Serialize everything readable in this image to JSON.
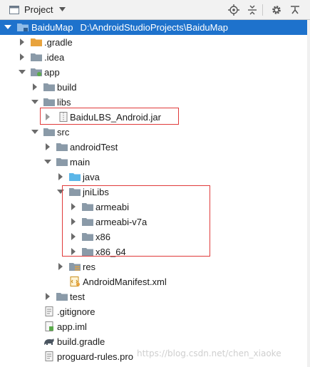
{
  "toolbar": {
    "title": "Project",
    "caret_icon": "dropdown-caret-icon",
    "buttons": [
      "locate-icon",
      "collapse-all-icon",
      "gear-icon",
      "hide-panel-icon"
    ]
  },
  "colors": {
    "selection": "#1e72cc",
    "folder": "#8a9aa8",
    "gradle_folder": "#e8a33d",
    "source_folder": "#5bb6e8",
    "highlight_box": "#e03a3a"
  },
  "tree": {
    "root": {
      "name": "BaiduMap",
      "path": "D:\\AndroidStudioProjects\\BaiduMap"
    },
    "gradle": ".gradle",
    "idea": ".idea",
    "app": "app",
    "build": "build",
    "libs": "libs",
    "jar": "BaiduLBS_Android.jar",
    "src": "src",
    "androidTest": "androidTest",
    "main": "main",
    "java": "java",
    "jniLibs": "jniLibs",
    "armeabi": "armeabi",
    "armeabi_v7a": "armeabi-v7a",
    "x86": "x86",
    "x86_64": "x86_64",
    "res": "res",
    "manifest": "AndroidManifest.xml",
    "test": "test",
    "gitignore": ".gitignore",
    "app_iml": "app.iml",
    "build_gradle": "build.gradle",
    "proguard": "proguard-rules.pro"
  },
  "watermark": "https://blog.csdn.net/chen_xiaoke"
}
